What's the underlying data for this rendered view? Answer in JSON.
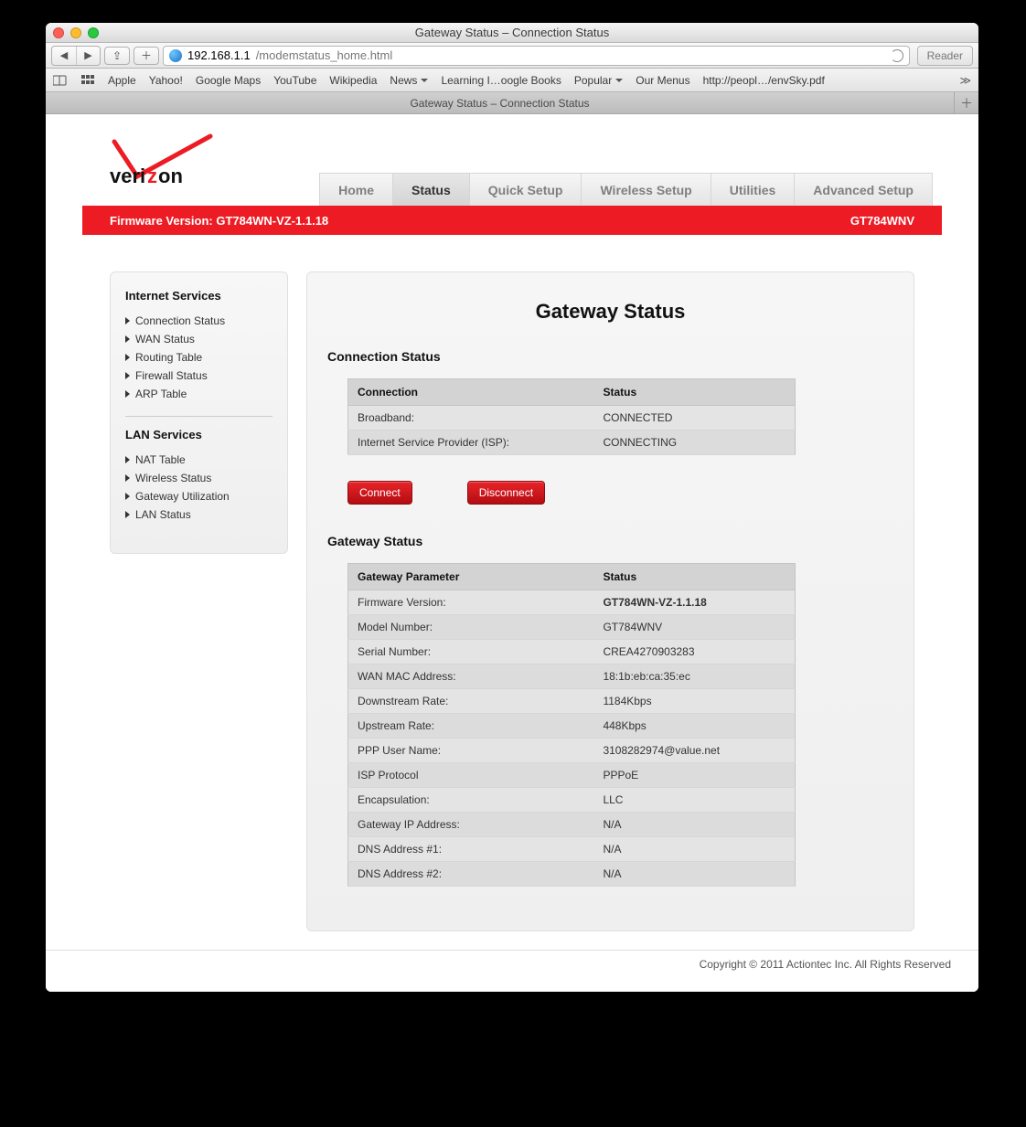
{
  "window": {
    "title": "Gateway Status – Connection Status"
  },
  "browser": {
    "url_host": "192.168.1.1",
    "url_path": "/modemstatus_home.html",
    "reader": "Reader",
    "bookmarks": [
      "Apple",
      "Yahoo!",
      "Google Maps",
      "YouTube",
      "Wikipedia",
      "News",
      "Learning I…oogle Books",
      "Popular",
      "Our Menus",
      "http://peopl…/envSky.pdf"
    ],
    "tab_label": "Gateway Status – Connection Status"
  },
  "nav": {
    "items": [
      "Home",
      "Status",
      "Quick Setup",
      "Wireless Setup",
      "Utilities",
      "Advanced Setup"
    ],
    "active": "Status"
  },
  "redbar": {
    "left_label": "Firmware Version:",
    "left_value": "GT784WN-VZ-1.1.18",
    "right": "GT784WNV"
  },
  "sidebar": {
    "g1_title": "Internet Services",
    "g1_items": [
      "Connection Status",
      "WAN Status",
      "Routing Table",
      "Firewall Status",
      "ARP Table"
    ],
    "g2_title": "LAN Services",
    "g2_items": [
      "NAT Table",
      "Wireless Status",
      "Gateway Utilization",
      "LAN Status"
    ]
  },
  "main": {
    "title": "Gateway Status",
    "conn_heading": "Connection Status",
    "conn_cols": [
      "Connection",
      "Status"
    ],
    "conn_rows": [
      {
        "label": "Broadband:",
        "value": "CONNECTED",
        "cls": "status-connected"
      },
      {
        "label": "Internet Service Provider (ISP):",
        "value": "CONNECTING",
        "cls": "status-connecting"
      }
    ],
    "btn_connect": "Connect",
    "btn_disconnect": "Disconnect",
    "gw_heading": "Gateway Status",
    "gw_cols": [
      "Gateway Parameter",
      "Status"
    ],
    "gw_rows": [
      {
        "label": "Firmware Version:",
        "value": "GT784WN-VZ-1.1.18",
        "cls": "fw-green"
      },
      {
        "label": "Model Number:",
        "value": "GT784WNV"
      },
      {
        "label": "Serial Number:",
        "value": "CREA4270903283"
      },
      {
        "label": "WAN MAC Address:",
        "value": "18:1b:eb:ca:35:ec"
      },
      {
        "label": "Downstream Rate:",
        "value": "1184Kbps"
      },
      {
        "label": "Upstream Rate:",
        "value": "448Kbps"
      },
      {
        "label": "PPP User Name:",
        "value": "3108282974@value.net"
      },
      {
        "label": "ISP Protocol",
        "value": "PPPoE"
      },
      {
        "label": "Encapsulation:",
        "value": "LLC"
      },
      {
        "label": "Gateway IP Address:",
        "value": "N/A"
      },
      {
        "label": "DNS Address #1:",
        "value": "N/A"
      },
      {
        "label": "DNS Address #2:",
        "value": "N/A"
      }
    ]
  },
  "footer": "Copyright © 2011 Actiontec Inc. All Rights Reserved"
}
